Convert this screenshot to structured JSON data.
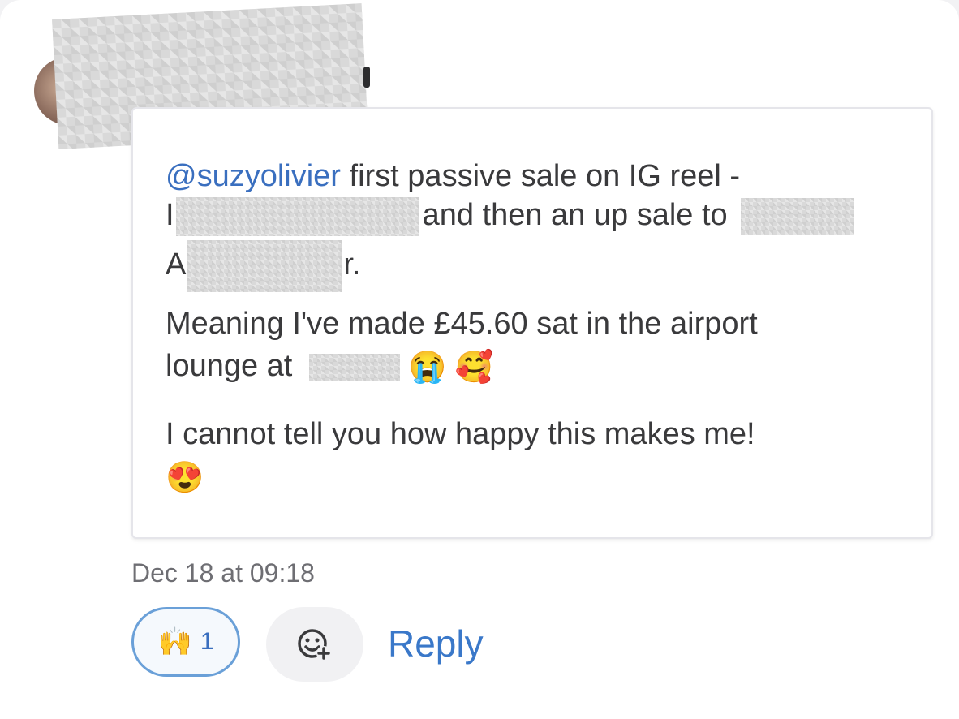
{
  "message": {
    "mention": "@suzyolivier",
    "line1_rest": " first passive sale on IG reel -",
    "line2_prefix": "I",
    "line2_rest": "and then an up sale to",
    "line3_prefix": "A",
    "line3_rest": "r.",
    "line4": "Meaning I've made £45.60 sat in the airport",
    "line5_text": "lounge at",
    "emoji_crying": "😭",
    "emoji_smiling_hearts": "🥰",
    "line6": "I cannot tell you how happy this makes me!",
    "emoji_heart_eyes": "😍"
  },
  "timestamp": "Dec 18 at 09:18",
  "reactions": {
    "emoji": "🙌",
    "count": "1"
  },
  "actions": {
    "add_reaction_icon": "smiley-plus-icon",
    "reply_label": "Reply"
  },
  "colors": {
    "mention": "#3a6fbf",
    "reply": "#3a78c9",
    "pill_border": "#6aa0d8"
  }
}
